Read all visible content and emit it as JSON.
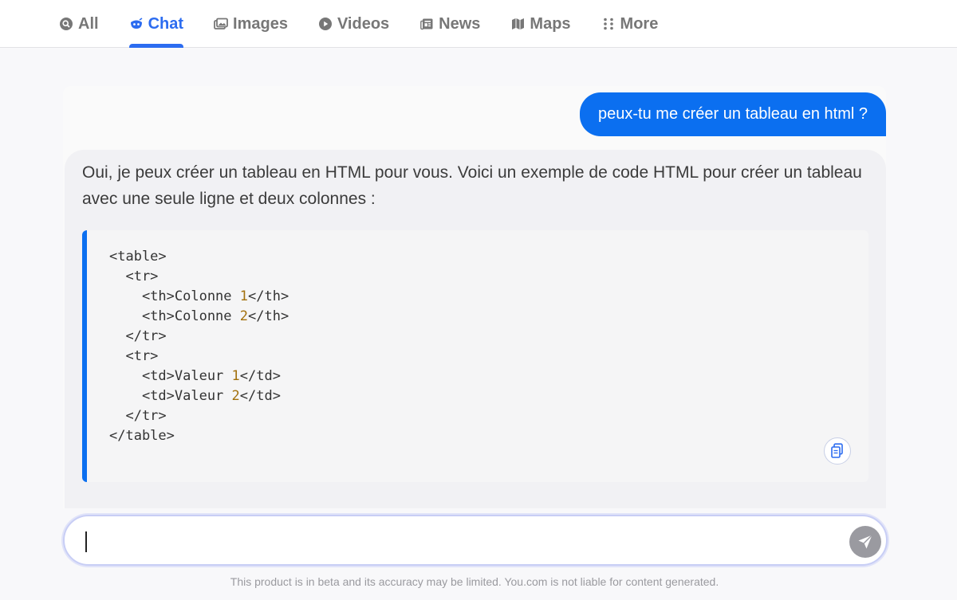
{
  "nav": {
    "tabs": [
      {
        "label": "All",
        "icon": "search-icon",
        "active": false
      },
      {
        "label": "Chat",
        "icon": "chat-icon",
        "active": true
      },
      {
        "label": "Images",
        "icon": "images-icon",
        "active": false
      },
      {
        "label": "Videos",
        "icon": "play-icon",
        "active": false
      },
      {
        "label": "News",
        "icon": "news-icon",
        "active": false
      },
      {
        "label": "Maps",
        "icon": "map-icon",
        "active": false
      },
      {
        "label": "More",
        "icon": "grid-dots-icon",
        "active": false
      }
    ],
    "active_color": "#2c6cf0"
  },
  "conversation": {
    "user_message": "peux-tu me créer un tableau en html ?",
    "assistant_intro": "Oui, je peux créer un tableau en HTML pour vous. Voici un exemple de code HTML pour créer un tableau avec une seule ligne et deux colonnes :",
    "code_lines": [
      "<table>",
      "  <tr>",
      "    <th>Colonne 1</th>",
      "    <th>Colonne 2</th>",
      "  </tr>",
      "  <tr>",
      "    <td>Valeur 1</td>",
      "    <td>Valeur 2</td>",
      "  </tr>",
      "</table>"
    ],
    "accent_color": "#0b6ff0"
  },
  "input": {
    "value": "",
    "placeholder": ""
  },
  "footer": {
    "disclaimer": "This product is in beta and its accuracy may be limited. You.com is not liable for content generated."
  }
}
